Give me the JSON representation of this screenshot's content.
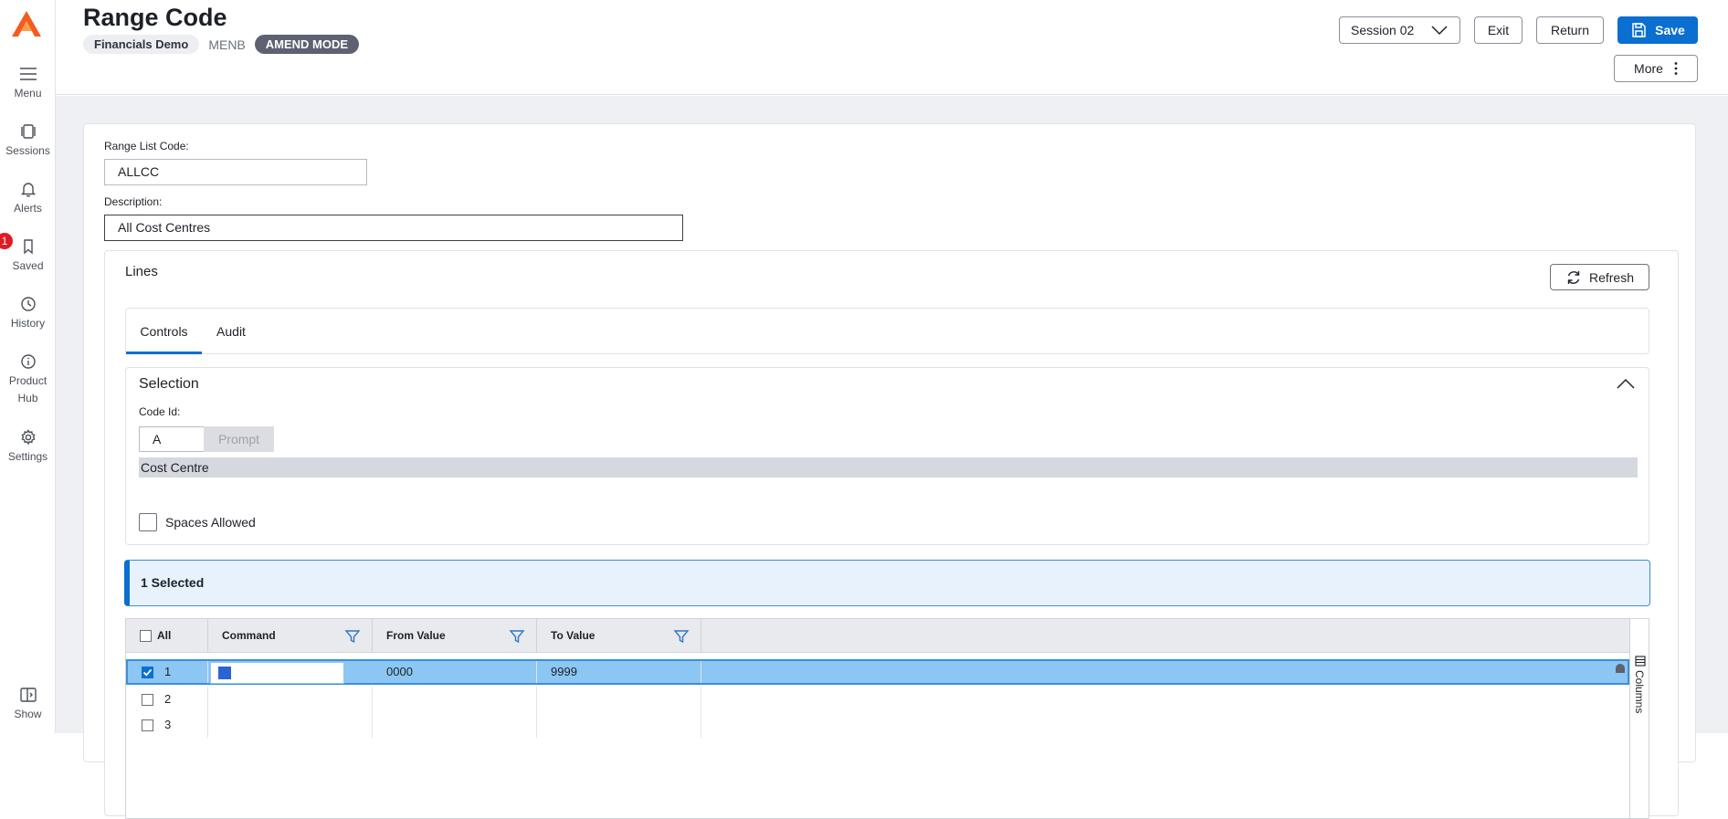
{
  "rail": {
    "items": [
      {
        "label": "Menu",
        "icon": "hamburger-icon"
      },
      {
        "label": "Sessions",
        "icon": "sessions-icon"
      },
      {
        "label": "Alerts",
        "icon": "bell-icon"
      },
      {
        "label": "Saved",
        "icon": "bookmark-icon",
        "badge": "1"
      },
      {
        "label": "History",
        "icon": "clock-icon"
      },
      {
        "label": "Product",
        "label2": "Hub",
        "icon": "info-icon"
      },
      {
        "label": "Settings",
        "icon": "gear-icon"
      }
    ],
    "show_label": "Show"
  },
  "header": {
    "title": "Range Code",
    "company": "Financials Demo",
    "module": "MENB",
    "mode": "AMEND MODE",
    "session": "Session 02",
    "exit": "Exit",
    "return": "Return",
    "save": "Save",
    "more": "More"
  },
  "form": {
    "range_list_code_label": "Range List Code:",
    "range_list_code": "ALLCC",
    "description_label": "Description:",
    "description": "All Cost Centres"
  },
  "lines": {
    "title": "Lines",
    "refresh": "Refresh",
    "tabs": [
      "Controls",
      "Audit"
    ],
    "selection": {
      "title": "Selection",
      "code_id_label": "Code Id:",
      "code_id": "A",
      "prompt": "Prompt",
      "code_desc": "Cost Centre",
      "spaces_allowed": "Spaces Allowed"
    },
    "selected_count": "1 Selected",
    "grid": {
      "columns": [
        "All",
        "Command",
        "From Value",
        "To Value"
      ],
      "rows": [
        {
          "num": "1",
          "from": "0000",
          "to": "9999",
          "checked": true
        },
        {
          "num": "2",
          "from": "",
          "to": "",
          "checked": false
        },
        {
          "num": "3",
          "from": "",
          "to": "",
          "checked": false
        }
      ],
      "side_panel": "Columns"
    }
  },
  "colors": {
    "accent": "#0a6fd1",
    "selected_row": "#8cc6f2",
    "badge": "#e01b24",
    "logo": "#f25c1f"
  }
}
